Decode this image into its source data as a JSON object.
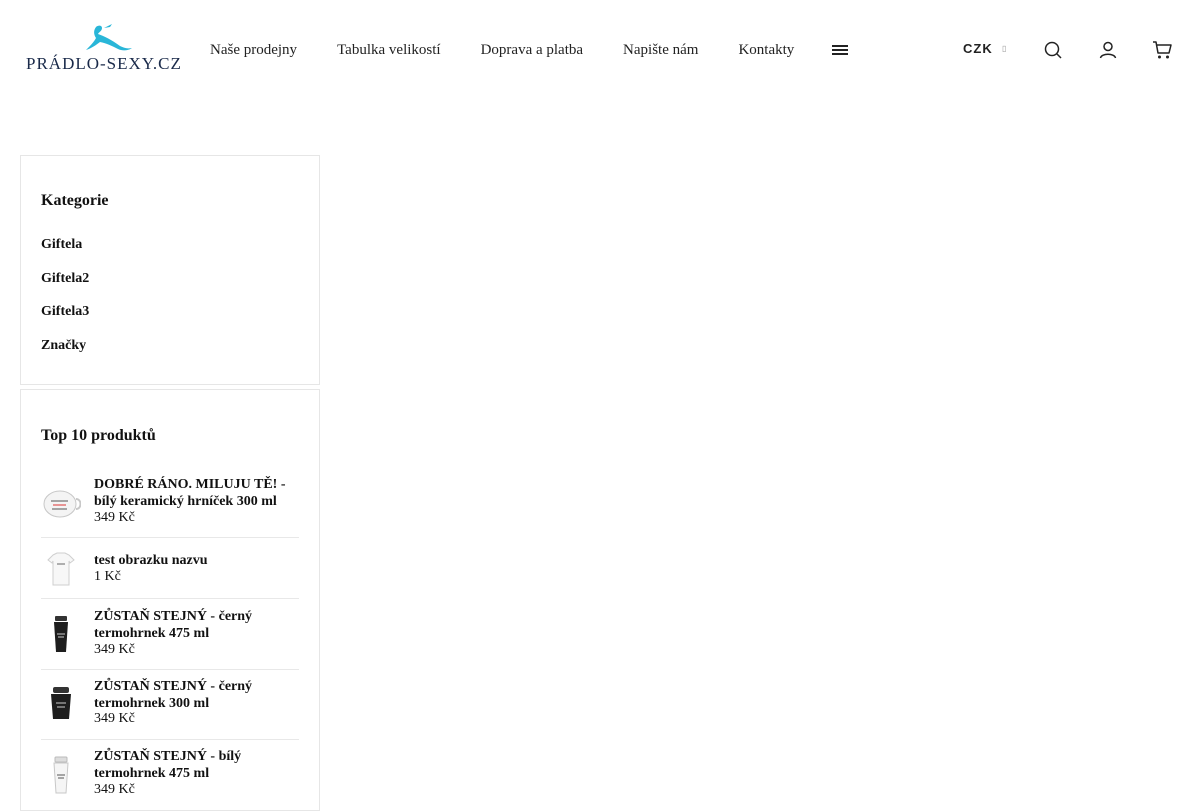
{
  "header": {
    "logo_text": "PRÁDLO-SEXY.CZ",
    "nav": [
      "Naše prodejny",
      "Tabulka velikostí",
      "Doprava a platba",
      "Napište nám",
      "Kontakty"
    ],
    "currency": "CZK"
  },
  "colors": {
    "logo_accent": "#29b6d8",
    "text": "#111111",
    "border": "#e6e6e6"
  },
  "icons": [
    "menu-icon",
    "search-icon",
    "user-icon",
    "cart-icon",
    "chevron-down-icon"
  ],
  "categories": {
    "title": "Kategorie",
    "items": [
      "Giftela",
      "Giftela2",
      "Giftela3",
      "Značky"
    ]
  },
  "top_products": {
    "title": "Top 10 produktů",
    "items": [
      {
        "name": "DOBRÉ RÁNO. MILUJU TĚ! - bílý keramický hrníček 300 ml",
        "price": "349 Kč"
      },
      {
        "name": "test obrazku nazvu",
        "price": "1 Kč"
      },
      {
        "name": "ZŮSTAŇ STEJNÝ - černý termohrnek 475 ml",
        "price": "349 Kč"
      },
      {
        "name": "ZŮSTAŇ STEJNÝ - černý termohrnek 300 ml",
        "price": "349 Kč"
      },
      {
        "name": "ZŮSTAŇ STEJNÝ - bílý termohrnek 475 ml",
        "price": "349 Kč"
      }
    ]
  }
}
